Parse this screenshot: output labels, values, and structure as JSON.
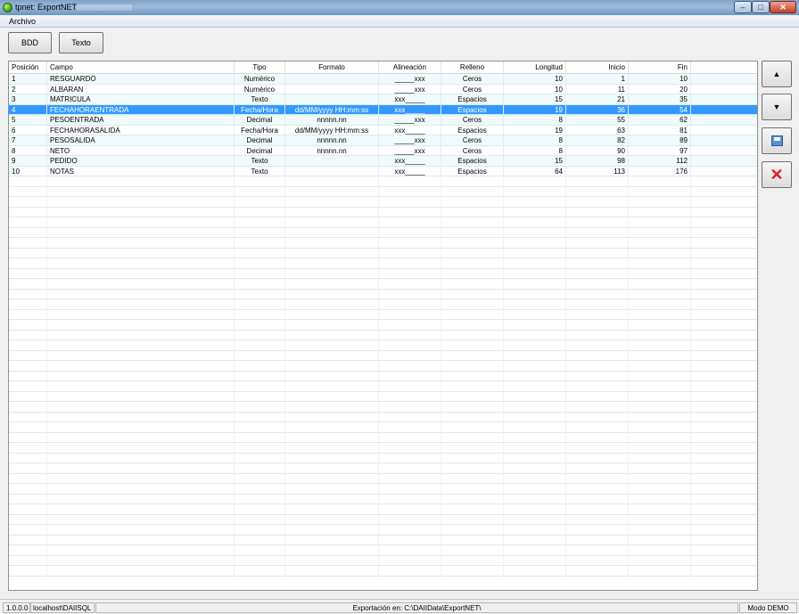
{
  "window": {
    "title": "tpnet: ExportNET",
    "controls": {
      "minimize": "–",
      "maximize": "□",
      "close": "✕"
    }
  },
  "menu": {
    "items": [
      "Archivo"
    ]
  },
  "toolbar": {
    "bdd_label": "BDD",
    "texto_label": "Texto"
  },
  "grid": {
    "headers": [
      "Posición",
      "Campo",
      "Tipo",
      "Formato",
      "Alineación",
      "Relleno",
      "Longitud",
      "Inicio",
      "Fin"
    ],
    "selected_row": 3,
    "rows": [
      [
        "1",
        "RESGUARDO",
        "Numérico",
        "",
        "_____xxx",
        "Ceros",
        "10",
        "1",
        "10"
      ],
      [
        "2",
        "ALBARAN",
        "Numérico",
        "",
        "_____xxx",
        "Ceros",
        "10",
        "11",
        "20"
      ],
      [
        "3",
        "MATRICULA",
        "Texto",
        "",
        "xxx_____",
        "Espacios",
        "15",
        "21",
        "35"
      ],
      [
        "4",
        "FECHAHORAENTRADA",
        "Fecha/Hora",
        "dd/MM/yyyy HH:mm:ss",
        "xxx_____",
        "Espacios",
        "19",
        "36",
        "54"
      ],
      [
        "5",
        "PESOENTRADA",
        "Decimal",
        "nnnnn.nn",
        "_____xxx",
        "Ceros",
        "8",
        "55",
        "62"
      ],
      [
        "6",
        "FECHAHORASALIDA",
        "Fecha/Hora",
        "dd/MM/yyyy HH:mm:ss",
        "xxx_____",
        "Espacios",
        "19",
        "63",
        "81"
      ],
      [
        "7",
        "PESOSALIDA",
        "Decimal",
        "nnnnn.nn",
        "_____xxx",
        "Ceros",
        "8",
        "82",
        "89"
      ],
      [
        "8",
        "NETO",
        "Decimal",
        "nnnnn.nn",
        "_____xxx",
        "Ceros",
        "8",
        "90",
        "97"
      ],
      [
        "9",
        "PEDIDO",
        "Texto",
        "",
        "xxx_____",
        "Espacios",
        "15",
        "98",
        "112"
      ],
      [
        "10",
        "NOTAS",
        "Texto",
        "",
        "xxx_____",
        "Espacios",
        "64",
        "113",
        "176"
      ]
    ]
  },
  "side_buttons": {
    "up_icon": "arrow-up-icon",
    "down_icon": "arrow-down-icon",
    "save_icon": "save-icon",
    "delete_icon": "delete-icon",
    "delete_color": "#e21a1a"
  },
  "status": {
    "version": "1.0.0.0",
    "server": "localhost\\DAIISQL",
    "export_path": "Exportación en: C:\\DAIIData\\ExportNET\\",
    "mode": "Modo DEMO"
  },
  "colors": {
    "selection": "#3399ff",
    "row_alt": "#effbfc"
  }
}
